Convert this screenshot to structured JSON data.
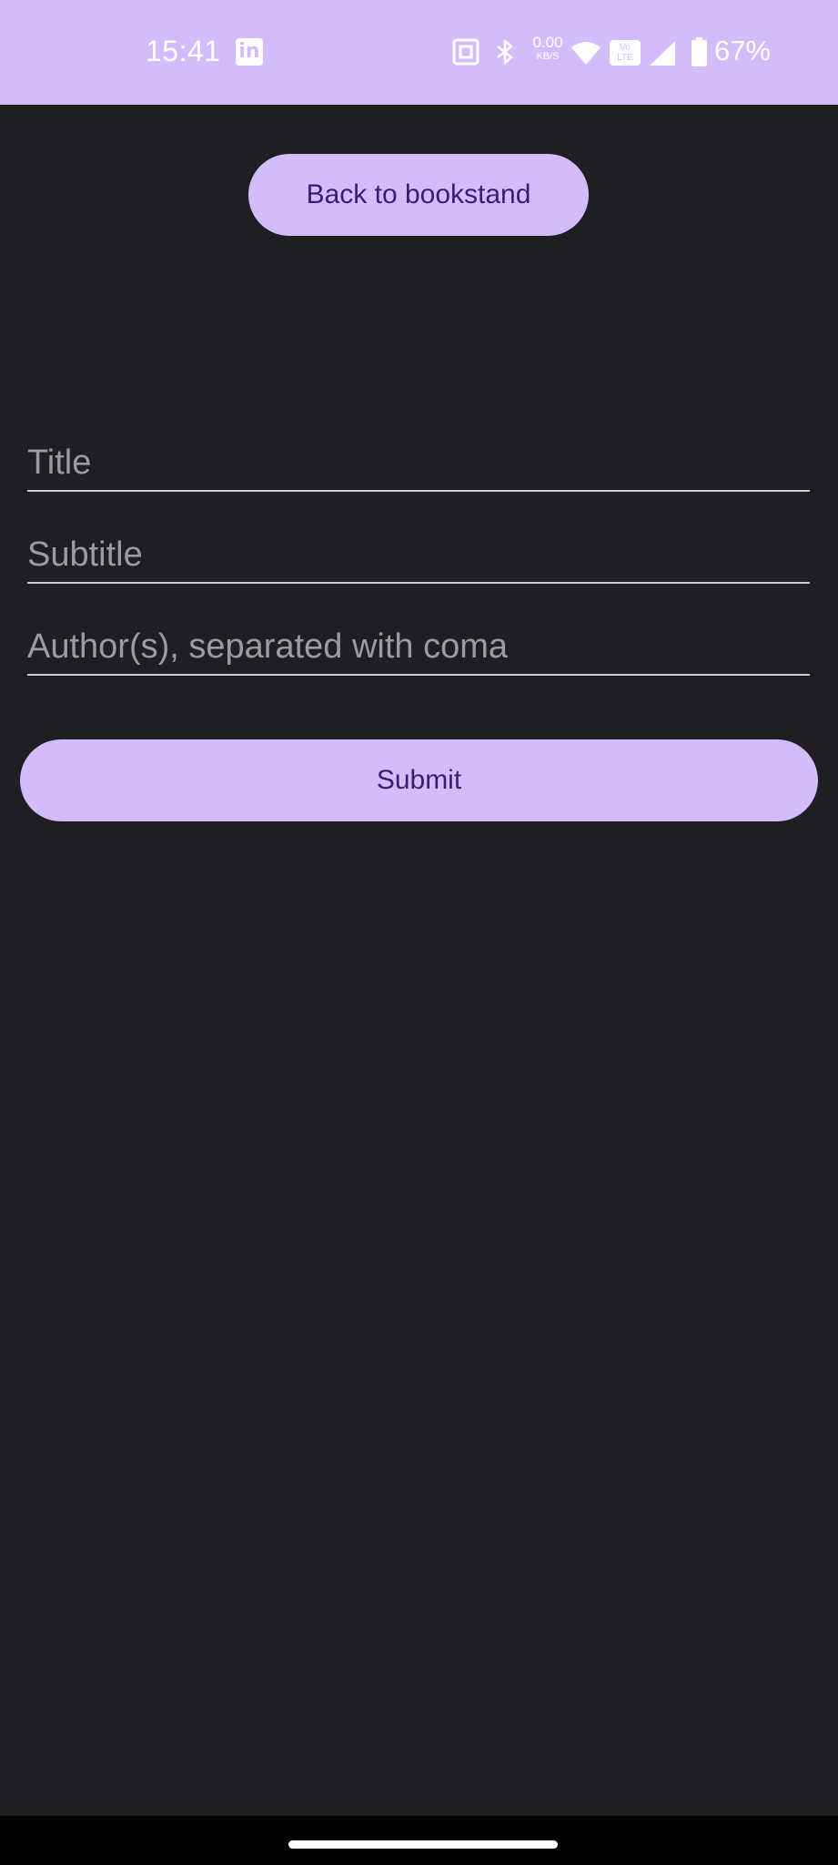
{
  "status_bar": {
    "time": "15:41",
    "net_speed_value": "0.00",
    "net_speed_unit": "KB/S",
    "volte_top": "Vo",
    "volte_bottom": "LTE",
    "battery_percent": "67%",
    "icons": [
      "linkedin-icon",
      "nfc-icon",
      "bluetooth-icon",
      "wifi-icon",
      "volte-icon",
      "signal-icon",
      "battery-icon"
    ],
    "background_color": "#d2bcfc"
  },
  "header": {
    "back_button_label": "Back to bookstand"
  },
  "form": {
    "title_placeholder": "Title",
    "subtitle_placeholder": "Subtitle",
    "authors_placeholder": "Author(s), separated with coma",
    "title_value": "",
    "subtitle_value": "",
    "authors_value": "",
    "submit_label": "Submit"
  },
  "theme": {
    "background": "#1f1e23",
    "accent": "#d2bcfc",
    "on_accent": "#381e72"
  }
}
